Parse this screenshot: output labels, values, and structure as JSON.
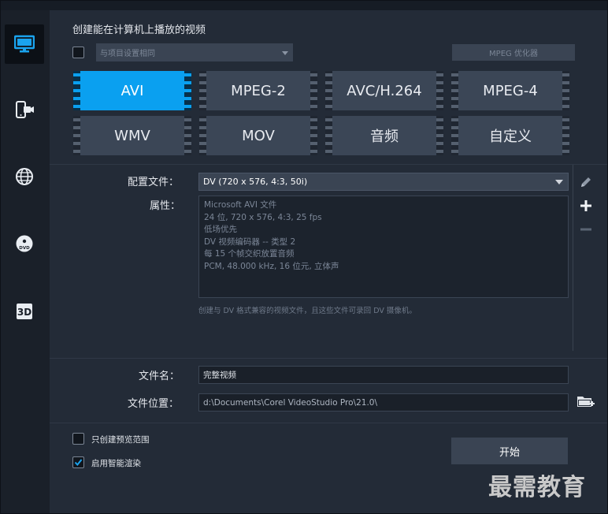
{
  "header": {
    "title": "创建能在计算机上播放的视频",
    "match_project_checkbox_checked": false,
    "match_project_dropdown": "与项目设置相同",
    "mpeg_optimizer_label": "MPEG 优化器"
  },
  "sidebar": {
    "items": [
      {
        "icon": "monitor-icon",
        "active": true
      },
      {
        "icon": "device-icon",
        "active": false
      },
      {
        "icon": "globe-icon",
        "active": false
      },
      {
        "icon": "dvd-icon",
        "active": false
      },
      {
        "icon": "3d-icon",
        "active": false
      }
    ]
  },
  "formats": [
    {
      "label": "AVI",
      "selected": true
    },
    {
      "label": "MPEG-2",
      "selected": false
    },
    {
      "label": "AVC/H.264",
      "selected": false
    },
    {
      "label": "MPEG-4",
      "selected": false
    },
    {
      "label": "WMV",
      "selected": false
    },
    {
      "label": "MOV",
      "selected": false
    },
    {
      "label": "音频",
      "selected": false
    },
    {
      "label": "自定义",
      "selected": false
    }
  ],
  "profile": {
    "label": "配置文件：",
    "value": "DV (720 x 576, 4:3, 50i)",
    "properties_label": "属性：",
    "properties": [
      "Microsoft AVI 文件",
      "24 位, 720 x 576, 4:3, 25 fps",
      "低场优先",
      "DV 视频编码器 -- 类型 2",
      "每 15 个帧交织放置音频",
      "PCM, 48.000 kHz, 16 位元, 立体声"
    ],
    "hint": "创建与 DV 格式兼容的视频文件，且这些文件可录回 DV 摄像机。"
  },
  "output": {
    "filename_label": "文件名：",
    "filename_value": "完整视频",
    "location_label": "文件位置：",
    "location_value": "d:\\Documents\\Corel VideoStudio Pro\\21.0\\"
  },
  "options": {
    "preview_only_label": "只创建预览范围",
    "preview_only_checked": false,
    "smart_render_label": "启用智能渲染",
    "smart_render_checked": true
  },
  "start_label": "开始",
  "watermark": "最需教育",
  "colors": {
    "accent": "#0aa0f0",
    "panel": "#232b37",
    "button": "#3b4656"
  }
}
